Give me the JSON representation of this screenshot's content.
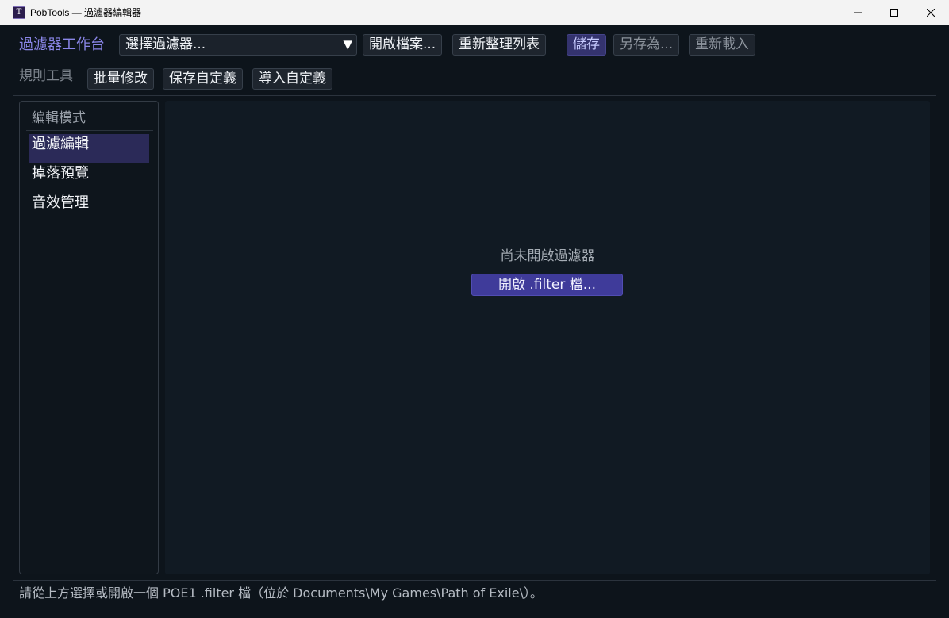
{
  "window": {
    "title": "PobTools — 過濾器編輯器",
    "app_icon_glyph": "T",
    "controls": [
      "minimize-icon",
      "maximize-icon",
      "close-icon"
    ]
  },
  "toolbar": {
    "brand": "過濾器工作台",
    "filter_select": {
      "value": "選擇過濾器...",
      "arrow": "▼"
    },
    "open_file": "開啟檔案...",
    "refresh_list": "重新整理列表",
    "save": "儲存",
    "save_as": "另存為...",
    "reload": "重新載入"
  },
  "rule_tools": {
    "label": "規則工具",
    "batch_edit": "批量修改",
    "save_custom": "保存自定義",
    "import_custom": "導入自定義"
  },
  "sidebar": {
    "heading": "編輯模式",
    "items": [
      {
        "label": "過濾編輯",
        "active": true
      },
      {
        "label": "掉落預覽",
        "active": false
      },
      {
        "label": "音效管理",
        "active": false
      }
    ]
  },
  "main": {
    "empty_message": "尚未開啟過濾器",
    "open_button": "開啟 .filter 檔..."
  },
  "status_bar": {
    "text": "請從上方選擇或開啟一個 POE1 .filter 檔（位於 Documents\\My Games\\Path of Exile\\）。"
  },
  "colors": {
    "background": "#0d141b",
    "accent": "#8a86e8",
    "primary_button": "#3f3b9a",
    "active_item": "#2b2a58"
  }
}
